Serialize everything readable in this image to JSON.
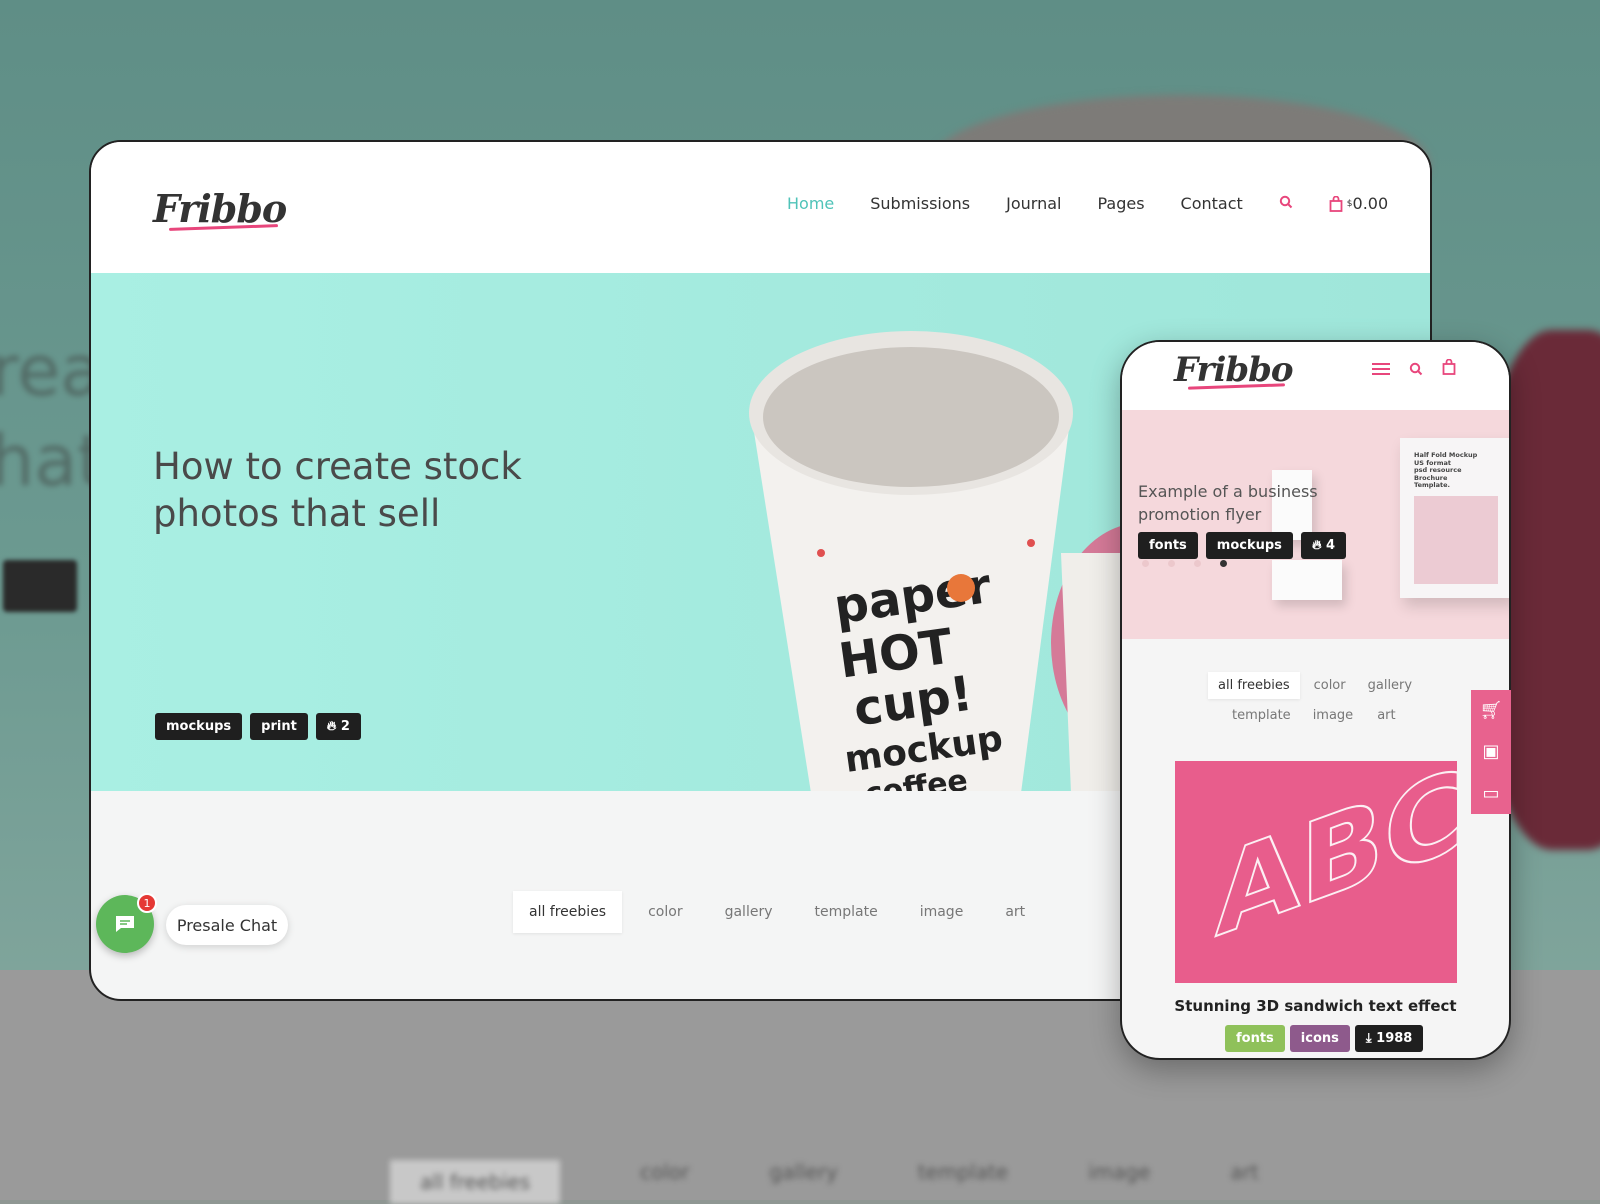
{
  "background": {
    "blurred_text_1": "rea",
    "blurred_text_2": "hat",
    "blurred_tabs": [
      "all freebies",
      "color",
      "gallery",
      "template",
      "image",
      "art"
    ]
  },
  "desktop": {
    "logo": "Fribbo",
    "nav": [
      {
        "label": "Home",
        "active": true
      },
      {
        "label": "Submissions"
      },
      {
        "label": "Journal"
      },
      {
        "label": "Pages"
      },
      {
        "label": "Contact"
      }
    ],
    "search_icon": "search-icon",
    "cart": {
      "icon": "shopping-bag-icon",
      "currency": "$",
      "amount": "0.00"
    },
    "hero": {
      "title": "How to create stock photos that sell",
      "tags": [
        "mockups",
        "print"
      ],
      "likes": "2",
      "slide_active": 2,
      "slide_count": 4,
      "image_text": [
        "paper",
        "HOT",
        "cup!",
        "mockup",
        "coffee"
      ]
    },
    "filters": [
      "all freebies",
      "color",
      "gallery",
      "template",
      "image",
      "art"
    ],
    "filter_selected": "all freebies",
    "chat": {
      "label": "Presale Chat",
      "badge": "1"
    }
  },
  "mobile": {
    "logo": "Fribbo",
    "hero": {
      "title": "Example of a business promotion flyer",
      "tags": [
        "fonts",
        "mockups"
      ],
      "likes": "4",
      "slide_active": 4,
      "slide_count": 4,
      "image_text": [
        "Half Fold Mockup",
        "US format",
        "psd resource",
        "Brochure",
        "Template."
      ]
    },
    "filters_row1": [
      "all freebies",
      "color",
      "gallery"
    ],
    "filters_row2": [
      "template",
      "image",
      "art"
    ],
    "card": {
      "title": "Stunning 3D sandwich text effect",
      "tags": [
        {
          "label": "fonts",
          "color": "#8fc15a"
        },
        {
          "label": "icons",
          "color": "#8e5a8c"
        }
      ],
      "downloads": "1988",
      "art_text": "ABC"
    }
  },
  "colors": {
    "accent": "#e8467c",
    "nav_active": "#4fc3b8",
    "hero_teal": "#a9efe3",
    "chat_green": "#5db75a",
    "card_pink": "#e85d8c"
  }
}
